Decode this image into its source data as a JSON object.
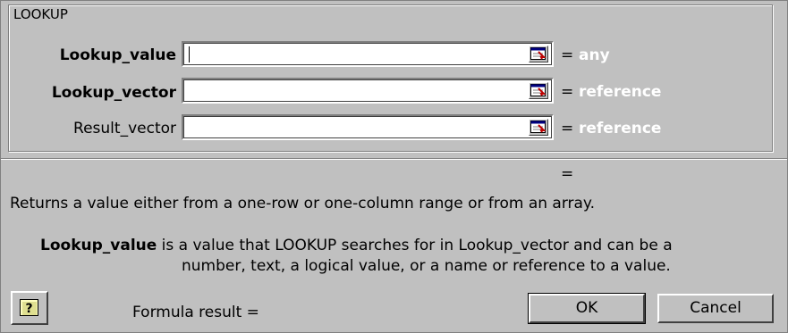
{
  "group": {
    "title": "LOOKUP"
  },
  "args": [
    {
      "label": "Lookup_value",
      "bold": true,
      "value": "",
      "equals": "=",
      "result": "any"
    },
    {
      "label": "Lookup_vector",
      "bold": true,
      "value": "",
      "equals": "=",
      "result": "reference"
    },
    {
      "label": "Result_vector",
      "bold": false,
      "value": "",
      "equals": "=",
      "result": "reference"
    }
  ],
  "formula_equals": "=",
  "description": "Returns a value either from a one-row or one-column range or from an array.",
  "arg_help": {
    "name": "Lookup_value",
    "line1": " is a value that LOOKUP searches for in Lookup_vector and can be a",
    "line2": "number, text, a logical value, or a name or reference to a value."
  },
  "footer": {
    "formula_result_label": "Formula result =",
    "ok_label": "OK",
    "cancel_label": "Cancel",
    "help_icon": "question-mark-icon"
  },
  "colors": {
    "dialog_bg": "#c0c0c0",
    "result_text": "#ffffff"
  }
}
